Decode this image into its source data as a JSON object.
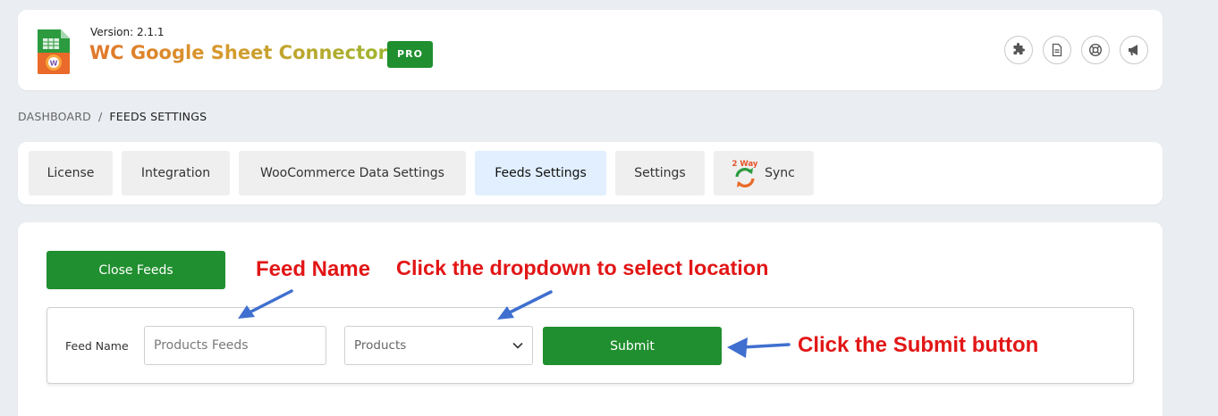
{
  "header": {
    "version": "Version: 2.1.1",
    "title": "WC Google Sheet Connector",
    "badge": "PRO",
    "icons": [
      "puzzle-icon",
      "document-icon",
      "support-icon",
      "megaphone-icon"
    ]
  },
  "breadcrumb": {
    "home": "DASHBOARD",
    "separator": "/",
    "current": "FEEDS SETTINGS"
  },
  "tabs": [
    {
      "label": "License",
      "active": false
    },
    {
      "label": "Integration",
      "active": false
    },
    {
      "label": "WooCommerce Data Settings",
      "active": false
    },
    {
      "label": "Feeds Settings",
      "active": true
    },
    {
      "label": "Settings",
      "active": false
    },
    {
      "label": "Sync",
      "active": false,
      "badge": "2 Way"
    }
  ],
  "feeds": {
    "close_label": "Close Feeds",
    "feed_name_label": "Feed Name",
    "feed_name_placeholder": "Products Feeds",
    "location_value": "Products",
    "submit_label": "Submit"
  },
  "annotations": {
    "feed_name": "Feed Name",
    "dropdown": "Click the dropdown to select location",
    "submit": "Click the Submit button"
  },
  "colors": {
    "primary_green": "#208f2f",
    "active_tab": "#e1efff",
    "annotation_red": "#e21616",
    "arrow_blue": "#3f6fcf"
  }
}
